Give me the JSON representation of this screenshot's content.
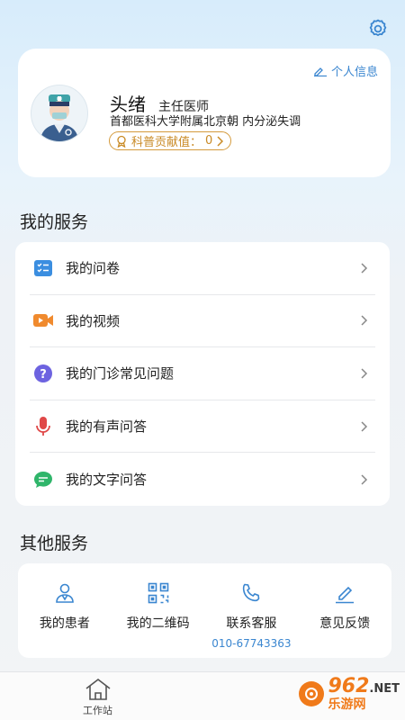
{
  "header": {
    "settings_icon": "gear-icon"
  },
  "profile": {
    "personal_info_label": "个人信息",
    "name": "头绪",
    "title": "主任医师",
    "hospital": "首都医科大学附属北京朝 内分泌失调",
    "contribution_label": "科普贡献值：",
    "contribution_value": "0"
  },
  "my_services": {
    "title": "我的服务",
    "items": [
      {
        "label": "我的问卷",
        "icon": "checklist-icon",
        "color": "#3b8ee0"
      },
      {
        "label": "我的视频",
        "icon": "video-icon",
        "color": "#f08a2e"
      },
      {
        "label": "我的门诊常见问题",
        "icon": "question-icon",
        "color": "#6d63e0"
      },
      {
        "label": "我的有声问答",
        "icon": "microphone-icon",
        "color": "#e04848"
      },
      {
        "label": "我的文字问答",
        "icon": "chat-icon",
        "color": "#2fb56a"
      }
    ]
  },
  "other_services": {
    "title": "其他服务",
    "items": [
      {
        "label": "我的患者",
        "icon": "patient-icon"
      },
      {
        "label": "我的二维码",
        "icon": "qrcode-icon"
      },
      {
        "label": "联系客服",
        "icon": "phone-icon",
        "phone": "010-67743363"
      },
      {
        "label": "意见反馈",
        "icon": "edit-icon"
      }
    ],
    "accent": "#3a86d0"
  },
  "bottom_nav": {
    "tabs": [
      {
        "label": "工作站",
        "icon": "home-icon"
      }
    ]
  },
  "watermark": {
    "number": "962",
    "suffix": ".NET",
    "sub": "乐游网"
  }
}
